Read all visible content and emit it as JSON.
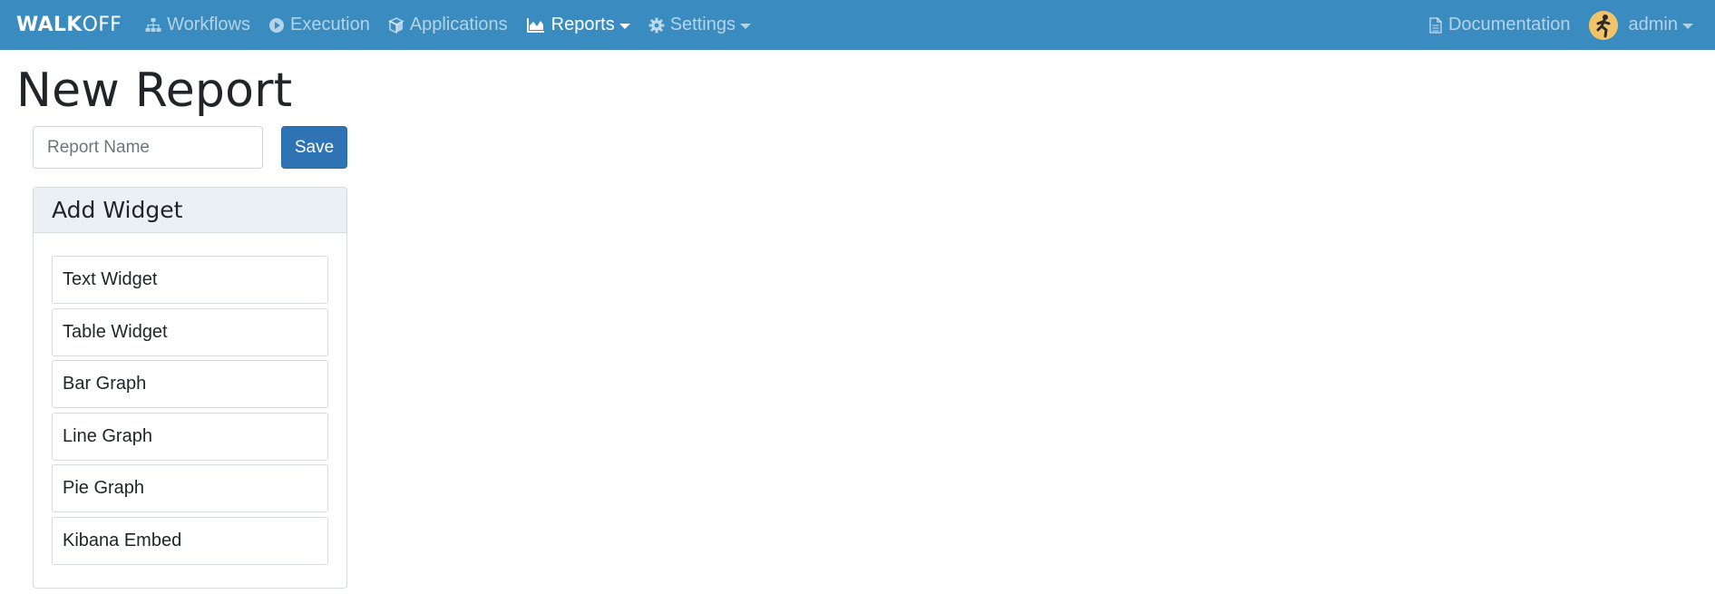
{
  "navbar": {
    "brand_bold": "WALK",
    "brand_light": "OFF",
    "items": [
      {
        "label": "Workflows",
        "icon": "sitemap-icon"
      },
      {
        "label": "Execution",
        "icon": "play-circle-icon"
      },
      {
        "label": "Applications",
        "icon": "cube-icon"
      },
      {
        "label": "Reports",
        "icon": "area-chart-icon",
        "active": true,
        "dropdown": true
      },
      {
        "label": "Settings",
        "icon": "gear-icon",
        "dropdown": true
      }
    ],
    "right": {
      "documentation_label": "Documentation",
      "user_label": "admin"
    },
    "colors": {
      "bar": "#3a8bbf"
    }
  },
  "page": {
    "title": "New Report",
    "report_name_placeholder": "Report Name",
    "save_label": "Save"
  },
  "add_widget": {
    "title": "Add Widget",
    "items": [
      "Text Widget",
      "Table Widget",
      "Bar Graph",
      "Line Graph",
      "Pie Graph",
      "Kibana Embed"
    ]
  }
}
